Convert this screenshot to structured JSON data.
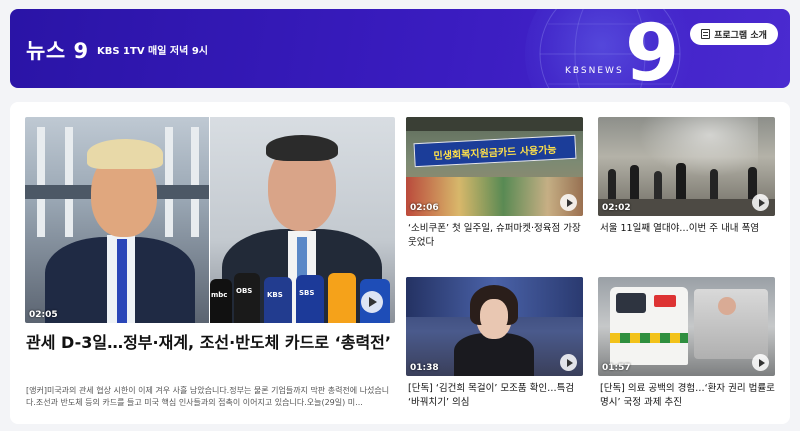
{
  "banner": {
    "title": "뉴스 9",
    "subtitle": "KBS 1TV 매일 저녁 9시",
    "brand": "KBSNEWS",
    "big_number": "9",
    "program_button": "프로그램 소개",
    "colors": {
      "start": "#2a14a6",
      "end": "#4a2ad0"
    }
  },
  "main_story": {
    "duration": "02:05",
    "headline": "관세 D-3일…정부·재계, 조선·반도체 카드로 ‘총력전’",
    "summary": "[앵커]미국과의 관세 협상 시한이 이제 겨우 사흘 남았습니다.정부는 물론 기업들까지 막판 총력전에 나섰습니다.조선과 반도체 등의 카드를 들고 미국 핵심 인사들과의 접촉이 이어지고 있습니다.오늘(29일) 미..."
  },
  "thumb_texts": {
    "banner_sign": "민생회복지원금카드 사용가능",
    "mic_mbc": "mbc",
    "mic_obs": "OBS",
    "mic_kbs": "KBS",
    "mic_sbs": "SBS"
  },
  "stories": [
    {
      "duration": "02:06",
      "headline": "‘소비쿠폰’ 첫 일주일, 슈퍼마켓·정육점 가장 웃었다"
    },
    {
      "duration": "02:02",
      "headline": "서울 11일째 열대야…이번 주 내내 폭염"
    },
    {
      "duration": "01:38",
      "headline": "[단독] ‘김건희 목걸이’ 모조품 확인…특검 ‘바꿔치기’ 의심"
    },
    {
      "duration": "01:57",
      "headline": "[단독] 의료 공백의 경험…‘환자 권리 법률로 명시’ 국정 과제 추진"
    }
  ]
}
